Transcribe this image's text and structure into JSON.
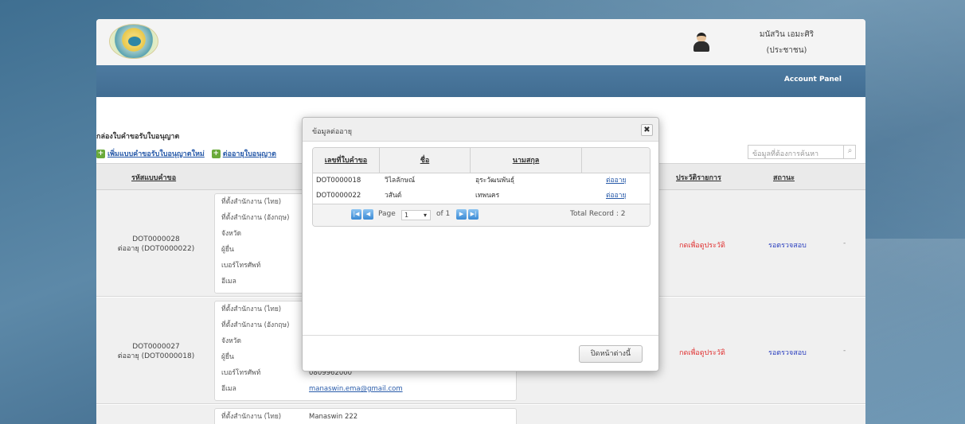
{
  "header": {
    "user_name": "มนัสวิน เอมะศิริ",
    "user_role": "(ประชาชน)",
    "account_panel": "Account Panel"
  },
  "page": {
    "section_title": "กล่องใบคำขอรับใบอนุญาต",
    "link_new": "เพิ่มแบบคำขอรับใบอนุญาตใหม่",
    "link_renew": "ต่ออายุใบอนุญาต",
    "search_placeholder": "ข้อมูลที่ต้องการค้นหา",
    "columns": {
      "request_id": "รหัสแบบคำขอ",
      "history": "ประวัติรายการ",
      "status": "สถานะ"
    }
  },
  "rows": [
    {
      "id": "DOT0000028",
      "renew": "ต่ออายุ (DOT0000022)",
      "details": [
        {
          "label": "ที่ตั้งสำนักงาน (ไทย)",
          "value": ""
        },
        {
          "label": "ที่ตั้งสำนักงาน (อังกฤษ)",
          "value": ""
        },
        {
          "label": "จังหวัด",
          "value": ""
        },
        {
          "label": "ผู้ยื่น",
          "value": ""
        },
        {
          "label": "เบอร์โทรศัพท์",
          "value": ""
        },
        {
          "label": "อีเมล",
          "value": ""
        }
      ],
      "history": "กดเพื่อดูประวัติ",
      "status": "รอตรวจสอบ",
      "dash": "-"
    },
    {
      "id": "DOT0000027",
      "renew": "ต่ออายุ (DOT0000018)",
      "details": [
        {
          "label": "ที่ตั้งสำนักงาน (ไทย)",
          "value": ""
        },
        {
          "label": "ที่ตั้งสำนักงาน (อังกฤษ)",
          "value": ""
        },
        {
          "label": "จังหวัด",
          "value": ""
        },
        {
          "label": "ผู้ยื่น",
          "value": ""
        },
        {
          "label": "เบอร์โทรศัพท์",
          "value": "0809962000"
        },
        {
          "label": "อีเมล",
          "value": "manaswin.ema@gmail.com"
        }
      ],
      "history": "กดเพื่อดูประวัติ",
      "status": "รอตรวจสอบ",
      "dash": "-"
    },
    {
      "details": [
        {
          "label": "ที่ตั้งสำนักงาน (ไทย)",
          "value": "Manaswin 222"
        }
      ]
    }
  ],
  "modal": {
    "title": "ข้อมูลต่ออายุ",
    "close_x": "✖",
    "columns": [
      "เลขที่ใบคำขอ",
      "ชื่อ",
      "นามสกุล",
      ""
    ],
    "rows": [
      {
        "number": "DOT0000018",
        "first": "วิไลลักษณ์",
        "last": "อุระวัฒนพันธุ์",
        "action": "ต่ออายุ"
      },
      {
        "number": "DOT0000022",
        "first": "วสันต์",
        "last": "เทพนคร",
        "action": "ต่ออายุ"
      }
    ],
    "pager": {
      "page_label": "Page",
      "page": "1",
      "of_label": "of 1",
      "total": "Total Record : 2"
    },
    "close_button": "ปิดหน้าต่างนี้"
  }
}
